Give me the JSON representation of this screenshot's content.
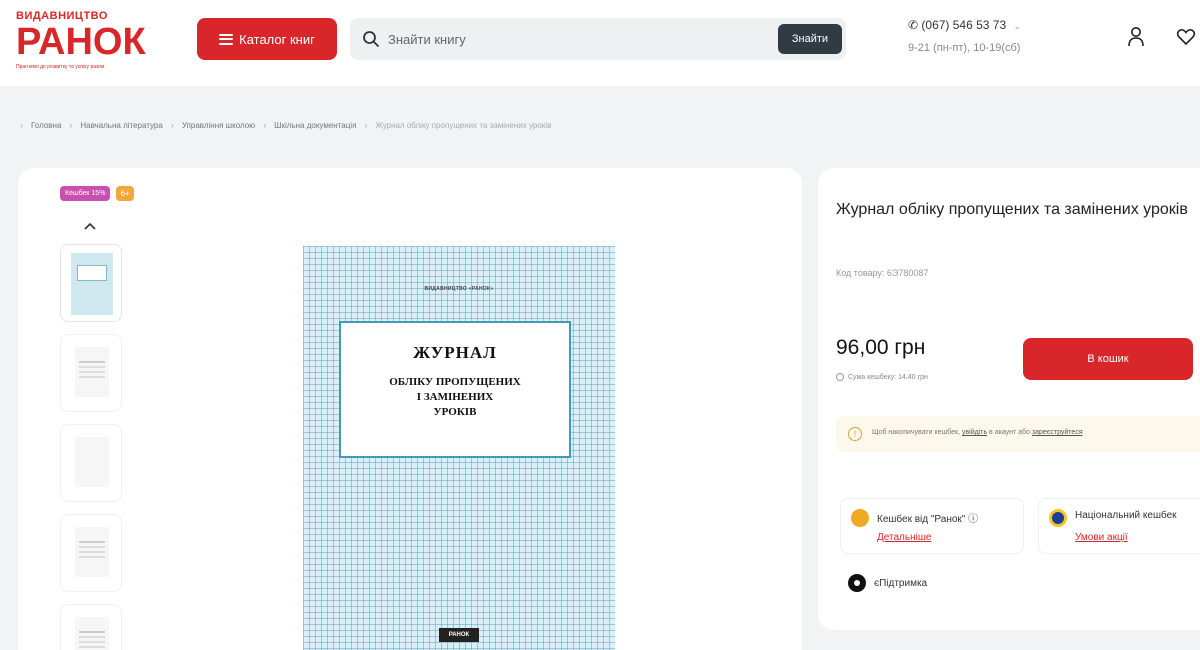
{
  "header": {
    "logo_top": "ВИДАВНИЦТВО",
    "logo_main": "РАНОК",
    "logo_sub": "Прагнемо до розвитку та успіху разом",
    "catalog_label": "Каталог книг",
    "search_placeholder": "Знайти книгу",
    "search_button": "Знайти",
    "phone": "(067) 546 53 73",
    "hours": "9-21 (пн-пт), 10-19(сб)"
  },
  "breadcrumbs": [
    "Головна",
    "Навчальна література",
    "Управління школою",
    "Шкільна документація",
    "Журнал обліку пропущених та замінених уроків"
  ],
  "gallery": {
    "badge_cashback": "Кешбек 15%",
    "badge_age": "6+",
    "cover": {
      "publisher_line": "ВИДАВНИЦТВО «РАНОК»",
      "title": "ЖУРНАЛ",
      "subtitle": "ОБЛІКУ ПРОПУЩЕНИХ\nІ ЗАМІНЕНИХ\nУРОКІВ",
      "logo": "РАНОК"
    }
  },
  "product": {
    "title": "Журнал обліку пропущених та замінених уроків",
    "sku": "Код товару: 6Э780087",
    "price": "96,00 грн",
    "cashback_sum": "Сума кешбеку: 14,40 грн",
    "cart_button": "В кошик",
    "notice_text": "Щоб накопичувати кешбек, ",
    "notice_login": "увійдіть",
    "notice_mid": " в акаунт або ",
    "notice_register": "зареєструйтеся",
    "features": [
      {
        "title": "Кешбек від \"Ранок\" ⓘ",
        "link": "Детальніше",
        "color": "#f0a923"
      },
      {
        "title": "Національний кешбек",
        "link": "Умови акції",
        "color": "#1d3f9a"
      }
    ],
    "support": "єПідтримка"
  }
}
